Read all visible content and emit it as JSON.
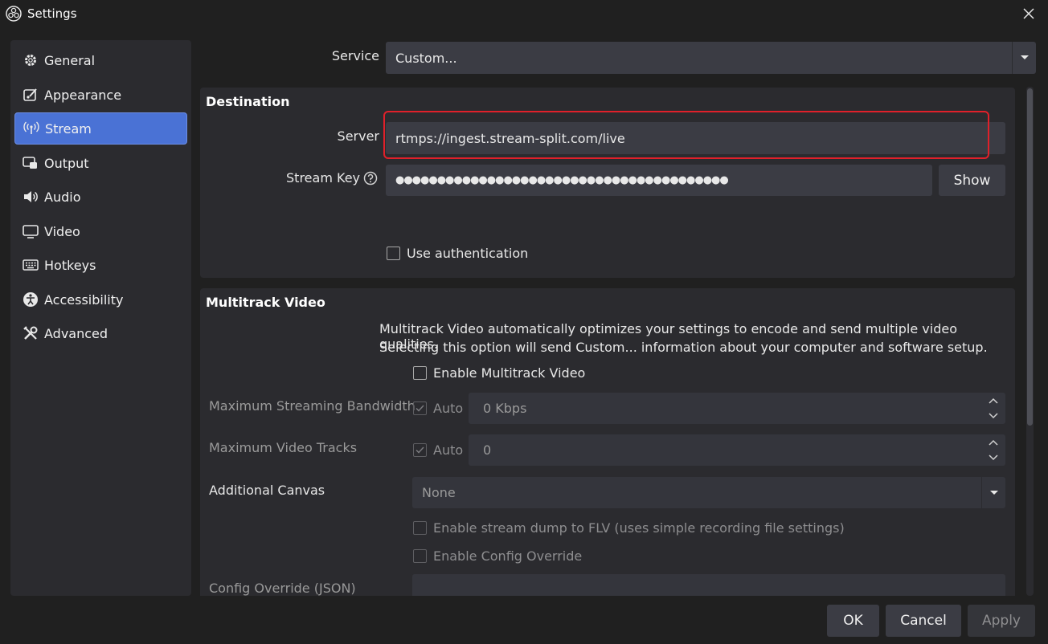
{
  "window": {
    "title": "Settings"
  },
  "sidebar": {
    "items": [
      {
        "label": "General",
        "icon": "gear-icon"
      },
      {
        "label": "Appearance",
        "icon": "appearance-icon"
      },
      {
        "label": "Stream",
        "icon": "antenna-icon",
        "active": true
      },
      {
        "label": "Output",
        "icon": "output-icon"
      },
      {
        "label": "Audio",
        "icon": "speaker-icon"
      },
      {
        "label": "Video",
        "icon": "monitor-icon"
      },
      {
        "label": "Hotkeys",
        "icon": "keyboard-icon"
      },
      {
        "label": "Accessibility",
        "icon": "accessibility-icon"
      },
      {
        "label": "Advanced",
        "icon": "wrench-icon"
      }
    ]
  },
  "service": {
    "label": "Service",
    "value": "Custom..."
  },
  "destination": {
    "title": "Destination",
    "server_label": "Server",
    "server_value": "rtmps://ingest.stream-split.com/live",
    "stream_key_label": "Stream Key",
    "stream_key_value": "●●●●●●●●●●●●●●●●●●●●●●●●●●●●●●●●●●●●●●●●",
    "show_label": "Show",
    "use_auth_label": "Use authentication"
  },
  "multitrack": {
    "title": "Multitrack Video",
    "description_line1": "Multitrack Video automatically optimizes your settings to encode and send multiple video qualities.",
    "description_line2": "Selecting this option will send Custom... information about your computer and software setup.",
    "enable_label": "Enable Multitrack Video",
    "max_bandwidth_label": "Maximum Streaming Bandwidth",
    "auto_label": "Auto",
    "max_bandwidth_value": "0 Kbps",
    "max_tracks_label": "Maximum Video Tracks",
    "max_tracks_value": "0",
    "additional_canvas_label": "Additional Canvas",
    "additional_canvas_value": "None",
    "stream_dump_label": "Enable stream dump to FLV (uses simple recording file settings)",
    "config_override_label": "Enable Config Override",
    "config_override_json_label": "Config Override (JSON)"
  },
  "footer": {
    "ok": "OK",
    "cancel": "Cancel",
    "apply": "Apply"
  },
  "colors": {
    "accent": "#4a72d5",
    "highlight": "#e0202a",
    "background": "#202020",
    "panel": "#2b2b2f"
  }
}
